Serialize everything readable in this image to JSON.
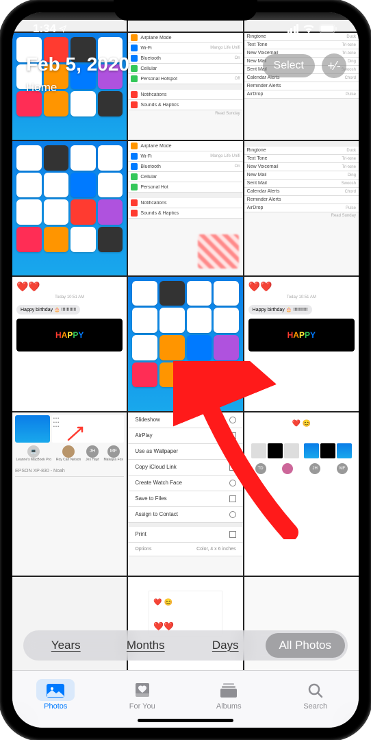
{
  "status": {
    "time": "1:34"
  },
  "header": {
    "date": "Feb 5, 2020",
    "location": "Home",
    "select_label": "Select",
    "zoom_label": "+⁄-"
  },
  "settings_a": {
    "r0": {
      "label": "Airplane Mode",
      "right": ""
    },
    "r1": {
      "label": "Wi-Fi",
      "right": "Mango Life Unifi"
    },
    "r2": {
      "label": "Bluetooth",
      "right": "On"
    },
    "r3": {
      "label": "Cellular",
      "right": ""
    },
    "r4": {
      "label": "Personal Hotspot",
      "right": "Off"
    },
    "r5": {
      "label": "Notifications",
      "right": ""
    },
    "r6": {
      "label": "Sounds & Haptics",
      "right": ""
    },
    "footer": "Read Sunday"
  },
  "settings_b": {
    "r0": {
      "label": "Airplane Mode",
      "right": ""
    },
    "r1": {
      "label": "Wi-Fi",
      "right": "Mango Life Unifi"
    },
    "r2": {
      "label": "Bluetooth",
      "right": "On"
    },
    "r3": {
      "label": "Cellular",
      "right": ""
    },
    "r4": {
      "label": "Personal Hot",
      "right": ""
    },
    "r5": {
      "label": "Notifications",
      "right": ""
    },
    "r6": {
      "label": "Sounds & Haptics",
      "right": ""
    }
  },
  "sounds_a": {
    "r0": {
      "label": "Ringtone",
      "right": "Duck"
    },
    "r1": {
      "label": "Text Tone",
      "right": "Tri-tone"
    },
    "r2": {
      "label": "New Voicemail",
      "right": "Tri-tone"
    },
    "r3": {
      "label": "New Mail",
      "right": "Ding"
    },
    "r4": {
      "label": "Sent Mail",
      "right": "Swoosh"
    },
    "r5": {
      "label": "Calendar Alerts",
      "right": "Chord"
    },
    "r6": {
      "label": "Reminder Alerts",
      "right": ""
    },
    "r7": {
      "label": "AirDrop",
      "right": "Pulse"
    }
  },
  "sounds_b": {
    "r0": {
      "label": "Ringtone",
      "right": "Duck"
    },
    "r1": {
      "label": "Text Tone",
      "right": "Tri-tone"
    },
    "r2": {
      "label": "New Voicemail",
      "right": "Tri-tone"
    },
    "r3": {
      "label": "New Mail",
      "right": "Ding"
    },
    "r4": {
      "label": "Sent Mail",
      "right": "Swoosh"
    },
    "r5": {
      "label": "Calendar Alerts",
      "right": "Chord"
    },
    "r6": {
      "label": "Reminder Alerts",
      "right": ""
    },
    "r7": {
      "label": "AirDrop",
      "right": "Pulse"
    },
    "footer": "Read Sunday"
  },
  "message": {
    "timestamp": "Today 10:51 AM",
    "bubble": "Happy birthday 🎂 !!!!!!!!!!!",
    "gif_text": "HAPPY"
  },
  "actions": {
    "r0": "Slideshow",
    "r1": "AirPlay",
    "r2": "Use as Wallpaper",
    "r3": "Copy iCloud Link",
    "r4": "Create Watch Face",
    "r5": "Save to Files",
    "r6": "Assign to Contact",
    "r7": "Print",
    "opts_l": "Options",
    "opts_r": "Color, 4 x 6 inches"
  },
  "share": {
    "c0": "Leanne's MacBook Pro",
    "c1": "Roy Carl Nelson",
    "c2": "JH",
    "c2l": "Jes Hayt",
    "c3": "MF",
    "c3l": "Makayla Fox",
    "printer": "EPSON XP-830 - Noah"
  },
  "mini_contacts": {
    "a": "TD",
    "b": "JH",
    "c": "MF"
  },
  "view_tabs": {
    "years": "Years",
    "months": "Months",
    "days": "Days",
    "all": "All Photos"
  },
  "tabs": {
    "photos": "Photos",
    "for_you": "For You",
    "albums": "Albums",
    "search": "Search"
  }
}
